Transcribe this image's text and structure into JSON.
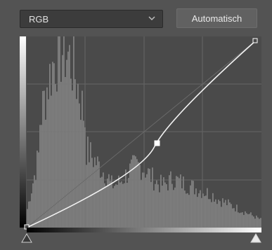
{
  "channel": {
    "selected": "RGB"
  },
  "buttons": {
    "auto_label": "Automatisch"
  },
  "colors": {
    "panel_bg": "#535353",
    "graph_bg": "#4a4a4a",
    "histogram": "#8c8c8c",
    "grid": "#7a7a7a",
    "curve": "#ffffff"
  },
  "curve": {
    "black_point": [
      0,
      0
    ],
    "white_point": [
      255,
      255
    ],
    "control_points": [
      [
        0,
        0
      ],
      [
        142,
        110
      ],
      [
        255,
        255
      ]
    ]
  },
  "icons": {
    "dropdown": "chevron-down-icon",
    "black_slider": "triangle-up-icon",
    "white_slider": "triangle-up-icon"
  }
}
